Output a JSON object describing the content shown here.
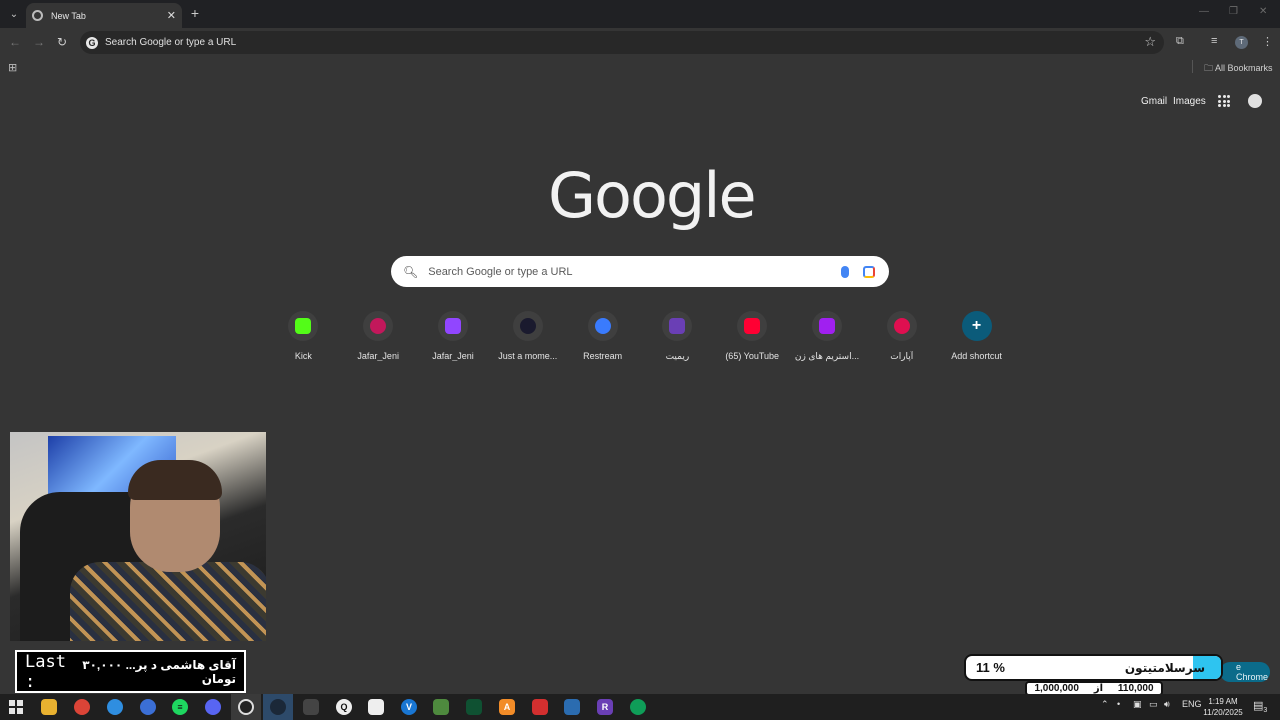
{
  "browser": {
    "tab_title": "New Tab",
    "omnibox_placeholder": "Search Google or type a URL",
    "all_bookmarks": "All Bookmarks",
    "profile_initial": "T"
  },
  "ntp": {
    "links": {
      "gmail": "Gmail",
      "images": "Images"
    },
    "logo_text": "Google",
    "search_placeholder": "Search Google or type a URL",
    "shortcuts": [
      {
        "label": "Kick",
        "icon": "kick-icon",
        "color": "#53fc18"
      },
      {
        "label": "Jafar_Jeni",
        "icon": "circle-icon",
        "color": "#c2185b"
      },
      {
        "label": "Jafar_Jeni",
        "icon": "twitch-icon",
        "color": "#9146ff"
      },
      {
        "label": "Just a mome...",
        "icon": "play-icon",
        "color": "#1a1a2e"
      },
      {
        "label": "Restream",
        "icon": "restream-icon",
        "color": "#3a7bfd"
      },
      {
        "label": "ریمیت",
        "icon": "remit-icon",
        "color": "#6a3fb5"
      },
      {
        "label": "(65) YouTube",
        "icon": "youtube-icon",
        "color": "#ff0033"
      },
      {
        "label": "استریم های زن...",
        "icon": "filter-icon",
        "color": "#a020f0"
      },
      {
        "label": "آپارات",
        "icon": "aparat-icon",
        "color": "#df0f50"
      },
      {
        "label": "Add shortcut",
        "icon": "plus-icon",
        "color": "#0b5b7a"
      }
    ]
  },
  "overlay": {
    "donation_last": "Last :",
    "donation_text": "آقای هاشمی د پر... ۳۰,۰۰۰ تومان",
    "goal_title": "سرسلامتیتون",
    "goal_percent": "11 %",
    "goal_progress": 0.11,
    "goal_current": "110,000",
    "goal_of": "از",
    "goal_target": "1,000,000",
    "chrome_pill": "e Chrome"
  },
  "taskbar": {
    "lang": "ENG",
    "time": "1:19 AM",
    "date": "11/20/2025",
    "notification_count": "3"
  }
}
